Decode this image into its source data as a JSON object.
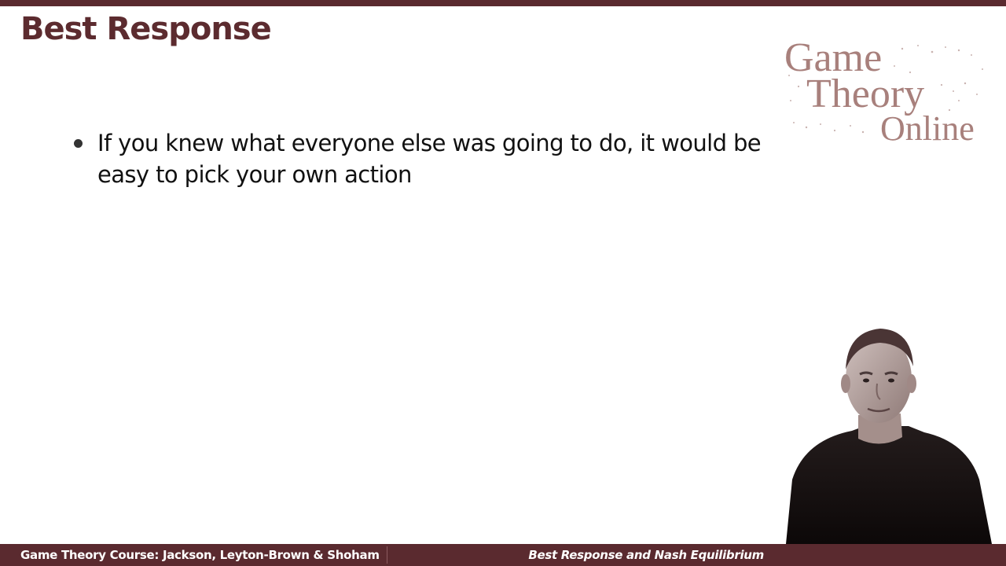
{
  "slide": {
    "title": "Best Response",
    "bullets": [
      "If you knew what everyone else was going to do, it would be easy to pick your own action"
    ]
  },
  "logo": {
    "line1": "Game",
    "line2": "Theory",
    "line3": "Online"
  },
  "footer": {
    "left": "Game Theory Course: Jackson, Leyton-Brown & Shoham",
    "right": "Best Response and Nash Equilibrium"
  },
  "colors": {
    "brand": "#5a2a2f",
    "logo": "#a8807c",
    "text": "#111111"
  }
}
